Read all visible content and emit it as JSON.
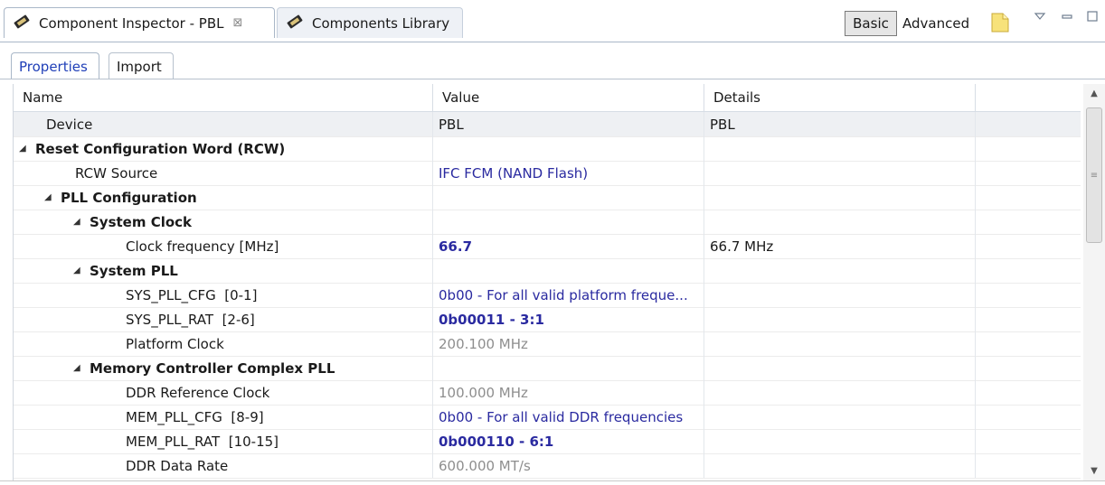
{
  "view_tabs": [
    {
      "label": "Component Inspector - PBL",
      "active": true,
      "icon": "component-tool-icon",
      "close": "⊠"
    },
    {
      "label": "Components Library",
      "active": false,
      "icon": "component-tool-icon"
    }
  ],
  "toolbar": {
    "basic_label": "Basic",
    "advanced_label": "Advanced",
    "note_icon": "new-note-icon",
    "menu_icon": "view-menu-icon",
    "minimize_icon": "minimize-icon",
    "maximize_icon": "maximize-icon"
  },
  "sub_tabs": [
    {
      "label": "Properties",
      "active": true
    },
    {
      "label": "Import",
      "active": false
    }
  ],
  "table": {
    "columns": [
      "Name",
      "Value",
      "Details"
    ],
    "rows": [
      {
        "name": "Device",
        "value": "PBL",
        "details": "PBL",
        "level": 1,
        "style": "device"
      },
      {
        "name": "Reset Configuration Word (RCW)",
        "value": "",
        "details": "",
        "level": 0,
        "group": true,
        "expanded": true
      },
      {
        "name": "RCW Source",
        "value": "IFC FCM (NAND Flash)",
        "details": "",
        "level": 2,
        "value_style": "link"
      },
      {
        "name": "PLL Configuration",
        "value": "",
        "details": "",
        "level": 1,
        "group": true,
        "expanded": true
      },
      {
        "name": "System Clock",
        "value": "",
        "details": "",
        "level": 2,
        "group": true,
        "expanded": true
      },
      {
        "name": "Clock frequency [MHz]",
        "value": "66.7",
        "details": "66.7 MHz",
        "level": 4,
        "value_style": "link-bold"
      },
      {
        "name": "System PLL",
        "value": "",
        "details": "",
        "level": 2,
        "group": true,
        "expanded": true
      },
      {
        "name": "SYS_PLL_CFG  [0-1]",
        "value": "0b00 - For all valid platform freque...",
        "details": "",
        "level": 4,
        "value_style": "link"
      },
      {
        "name": "SYS_PLL_RAT  [2-6]",
        "value": "0b00011 - 3:1",
        "details": "",
        "level": 4,
        "value_style": "link-bold"
      },
      {
        "name": "Platform Clock",
        "value": "200.100 MHz",
        "details": "",
        "level": 4,
        "value_style": "gray"
      },
      {
        "name": "Memory Controller Complex PLL",
        "value": "",
        "details": "",
        "level": 2,
        "group": true,
        "expanded": true
      },
      {
        "name": "DDR Reference Clock",
        "value": "100.000 MHz",
        "details": "",
        "level": 4,
        "value_style": "gray"
      },
      {
        "name": "MEM_PLL_CFG  [8-9]",
        "value": "0b00 - For all valid DDR frequencies",
        "details": "",
        "level": 4,
        "value_style": "link"
      },
      {
        "name": "MEM_PLL_RAT  [10-15]",
        "value": "0b000110 - 6:1",
        "details": "",
        "level": 4,
        "value_style": "link-bold"
      },
      {
        "name": "DDR Data Rate",
        "value": "600.000 MT/s",
        "details": "",
        "level": 4,
        "value_style": "gray"
      }
    ]
  },
  "scrollbar": {
    "up_icon": "scroll-up-arrow-icon",
    "down_icon": "scroll-down-arrow-icon",
    "thumb_grip": "≡",
    "position": 0.06
  }
}
